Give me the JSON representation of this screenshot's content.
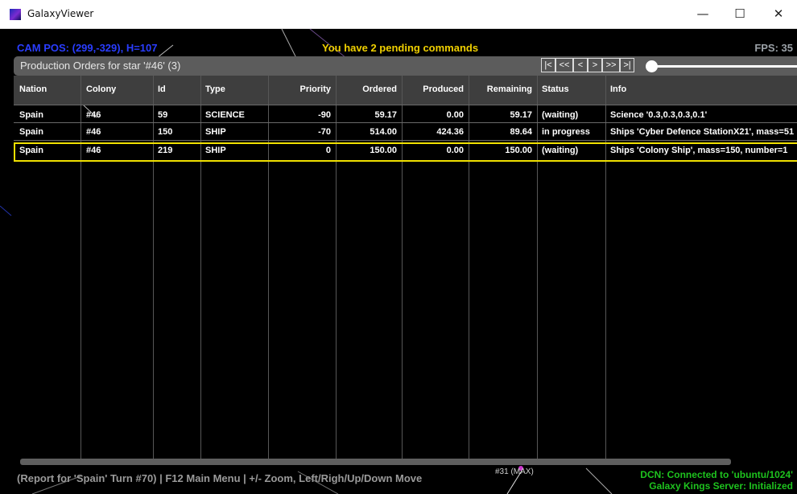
{
  "window": {
    "title": "GalaxyViewer",
    "minimize": "—",
    "maximize": "☐",
    "close": "✕"
  },
  "hud": {
    "cam_pos": "CAM POS: (299,-329), H=107",
    "pending": "You have 2 pending commands",
    "fps": "FPS: 35"
  },
  "panel": {
    "title": "Production Orders for star '#46' (3)",
    "nav": {
      "first": "|<",
      "prev_page": "<<",
      "prev": "<",
      "next": ">",
      "next_page": ">>",
      "last": ">|"
    }
  },
  "table": {
    "columns": [
      "Nation",
      "Colony",
      "Id",
      "Type",
      "Priority",
      "Ordered",
      "Produced",
      "Remaining",
      "Status",
      "Info"
    ],
    "rows": [
      [
        "Spain",
        "#46",
        "59",
        "SCIENCE",
        "-90",
        "59.17",
        "0.00",
        "59.17",
        "(waiting)",
        "Science '0.3,0.3,0.3,0.1'"
      ],
      [
        "Spain",
        "#46",
        "150",
        "SHIP",
        "-70",
        "514.00",
        "424.36",
        "89.64",
        "in progress",
        "Ships 'Cyber Defence StationX21', mass=51"
      ],
      [
        "Spain",
        "#46",
        "219",
        "SHIP",
        "0",
        "150.00",
        "0.00",
        "150.00",
        "(waiting)",
        "Ships 'Colony Ship', mass=150, number=1"
      ]
    ],
    "selected_row": 2
  },
  "status": {
    "left": "(Report for 'Spain' Turn #70) | F12 Main Menu | +/- Zoom, Left/Righ/Up/Down Move",
    "turn_label": "#31 (MAX)",
    "dcn": "DCN: Connected to 'ubuntu/1024'",
    "server": "Galaxy Kings Server: Initialized"
  },
  "colors": {
    "cam": "#2a3dff",
    "pending": "#f0d000",
    "selection": "#f0e000",
    "connected": "#1ec31e"
  }
}
